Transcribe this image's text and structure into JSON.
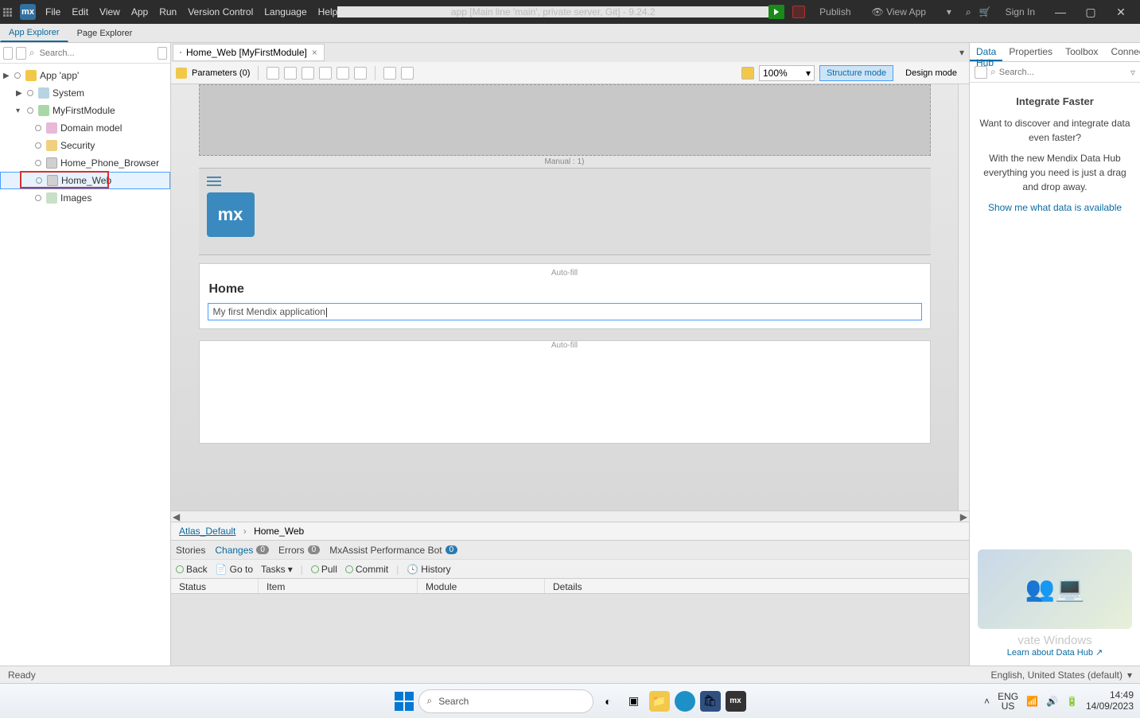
{
  "titlebar": {
    "menus": [
      "File",
      "Edit",
      "View",
      "App",
      "Run",
      "Version Control",
      "Language",
      "Help"
    ],
    "center": "app [Main line 'main', private server, Git] - 9.24.2",
    "publish": "Publish",
    "viewapp": "View App",
    "signin": "Sign In"
  },
  "explorer_tabs": {
    "app_explorer": "App Explorer",
    "page_explorer": "Page Explorer"
  },
  "left": {
    "search_placeholder": "Search...",
    "nodes": {
      "app": "App 'app'",
      "system": "System",
      "module": "MyFirstModule",
      "domain": "Domain model",
      "security": "Security",
      "phone": "Home_Phone_Browser",
      "web": "Home_Web",
      "images": "Images"
    }
  },
  "doc_tab": {
    "label": "Home_Web [MyFirstModule]"
  },
  "toolbar": {
    "parameters": "Parameters (0)",
    "zoom": "100%",
    "structure": "Structure mode",
    "design": "Design mode"
  },
  "canvas": {
    "manual_label": "Manual : 1)",
    "autofill": "Auto-fill",
    "logo_text": "mx",
    "home_heading": "Home",
    "text_value": "My first Mendix application"
  },
  "breadcrumb": {
    "a": "Atlas_Default",
    "b": "Home_Web"
  },
  "bottom_tabs": {
    "stories": "Stories",
    "changes": "Changes",
    "changes_badge": "0",
    "errors": "Errors",
    "errors_badge": "0",
    "perf": "MxAssist Performance Bot",
    "perf_badge": "0"
  },
  "bottom_toolbar": {
    "back": "Back",
    "goto": "Go to",
    "tasks": "Tasks",
    "pull": "Pull",
    "commit": "Commit",
    "history": "History"
  },
  "grid_headers": {
    "status": "Status",
    "item": "Item",
    "module": "Module",
    "details": "Details"
  },
  "right_tabs": {
    "datahub": "Data Hub",
    "properties": "Properties",
    "toolbox": "Toolbox",
    "connector": "Connector"
  },
  "right": {
    "search_placeholder": "Search...",
    "title": "Integrate Faster",
    "p1": "Want to discover and integrate data even faster?",
    "p2": "With the new Mendix Data Hub everything you need is just a drag and drop away.",
    "link": "Show me what data is available",
    "watermark": "vate Windows",
    "subnote": "Learn about Data Hub ↗"
  },
  "status": {
    "ready": "Ready",
    "lang": "English, United States (default)"
  },
  "taskbar": {
    "search": "Search",
    "lang1": "ENG",
    "lang2": "US",
    "time": "14:49",
    "date": "14/09/2023"
  }
}
